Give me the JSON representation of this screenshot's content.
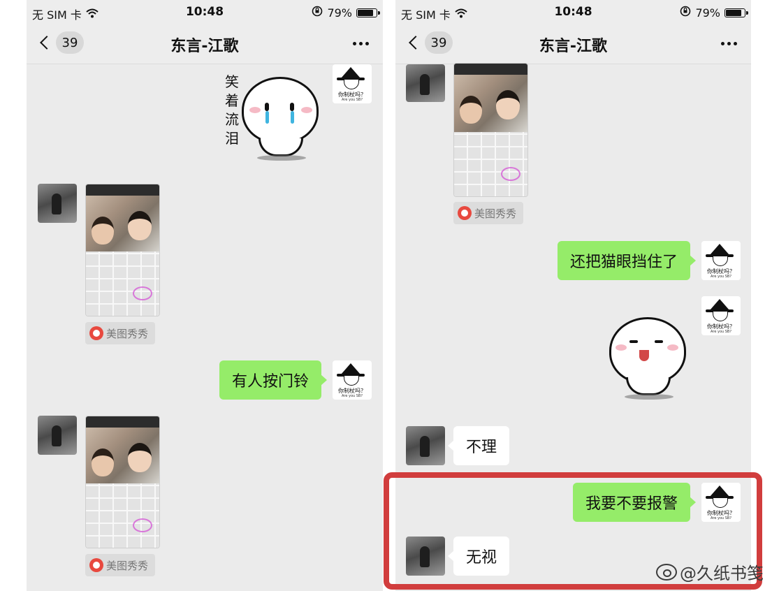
{
  "status_bar": {
    "carrier": "无 SIM 卡",
    "time": "10:48",
    "battery": "79%"
  },
  "navbar": {
    "unread_count": "39",
    "title": "东言-江歌"
  },
  "left": {
    "sticker_caption": [
      "笑",
      "着",
      "流",
      "泪"
    ],
    "app_tag_1": "美图秀秀",
    "app_tag_2": "美图秀秀",
    "msg_doorbell": "有人按门铃"
  },
  "right": {
    "app_tag": "美图秀秀",
    "msg_peephole": "还把猫眼挡住了",
    "msg_ignore": "不理",
    "msg_police": "我要不要报警",
    "msg_disregard": "无视"
  },
  "my_avatar": {
    "text": "你制杖吗？",
    "subtext": "Are you SB?"
  },
  "watermark": "@久纸书笺",
  "colors": {
    "my_bubble": "#95ec69",
    "friend_bubble": "#ffffff",
    "chat_bg": "#ebebeb",
    "highlight": "#d13d3d"
  }
}
